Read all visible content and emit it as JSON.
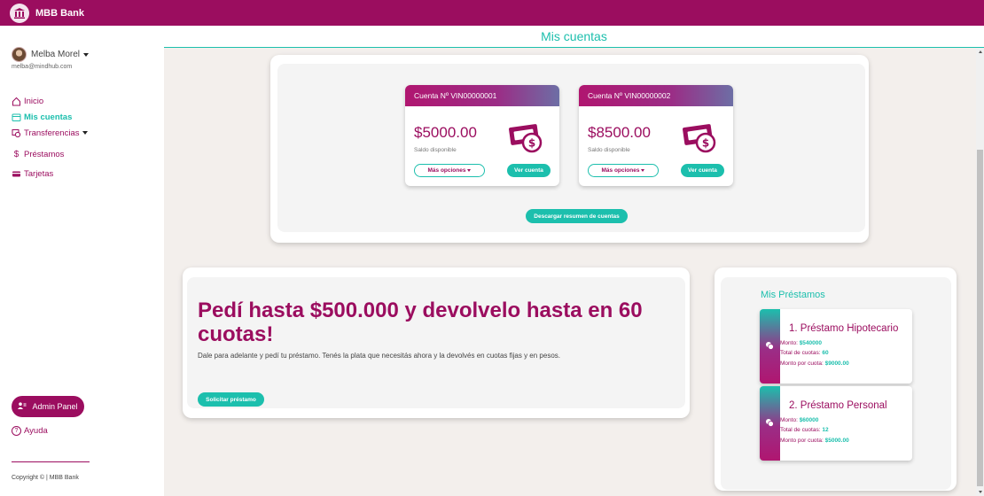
{
  "app": {
    "brand": "MBB Bank"
  },
  "user": {
    "name": "Melba Morel",
    "email": "melba@mindhub.com"
  },
  "nav": {
    "inicio": "Inicio",
    "cuentas": "Mis cuentas",
    "transferencias": "Transferencias",
    "prestamos": "Préstamos",
    "tarjetas": "Tarjetas"
  },
  "sidebar": {
    "admin_label": "Admin Panel",
    "help_label": "Ayuda",
    "copyright": "Copyright © | MBB Bank"
  },
  "page": {
    "title": "Mis cuentas"
  },
  "accounts": [
    {
      "header": "Cuenta Nº VIN00000001",
      "balance": "$5000.00",
      "balance_label": "Saldo disponible",
      "more_label": "Más opciones",
      "view_label": "Ver cuenta"
    },
    {
      "header": "Cuenta Nº VIN00000002",
      "balance": "$8500.00",
      "balance_label": "Saldo disponible",
      "more_label": "Más opciones",
      "view_label": "Ver cuenta"
    }
  ],
  "download_label": "Descargar resumen de cuentas",
  "promo": {
    "title": "Pedí hasta $500.000 y devolvelo hasta en 60 cuotas!",
    "text": "Dale para adelante y pedí tu préstamo. Tenés la plata que necesitás ahora y la devolvés en cuotas fijas y en pesos.",
    "button": "Solicitar préstamo"
  },
  "loans": {
    "title": "Mis Préstamos",
    "items": [
      {
        "title": "1.    Préstamo Hipotecario",
        "monto_label": "Monto:",
        "monto": "$540000",
        "cuotas_label": "Total de cuotas:",
        "cuotas": "60",
        "por_cuota_label": "Monto por cuota:",
        "por_cuota": "$9000.00"
      },
      {
        "title": "2.    Préstamo Personal",
        "monto_label": "Monto:",
        "monto": "$60000",
        "cuotas_label": "Total de cuotas:",
        "cuotas": "12",
        "por_cuota_label": "Monto por cuota:",
        "por_cuota": "$5000.00"
      }
    ]
  },
  "colors": {
    "brand": "#9b0d5f",
    "accent": "#1cbfad",
    "background": "#f3efec"
  },
  "icons": [
    "bank-icon",
    "home-icon",
    "wallet-icon",
    "transfer-icon",
    "dollar-icon",
    "card-icon",
    "admin-icon",
    "help-icon",
    "money-icon",
    "coin-icon"
  ]
}
